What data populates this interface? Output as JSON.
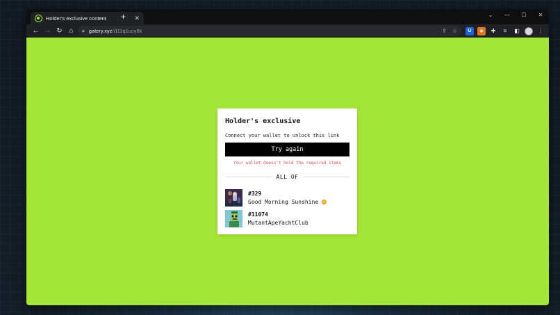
{
  "browser": {
    "tab": {
      "title": "Holder's exclusive content",
      "favicon": "gatery-icon"
    },
    "window_controls": [
      "chevron-down-icon",
      "minimize-icon",
      "maximize-icon",
      "close-icon"
    ],
    "url": {
      "host": "gatery.xyz",
      "path": "/i111q1ucy6k"
    },
    "extensions": [
      "bitwarden-icon",
      "metamask-icon",
      "puzzle-icon",
      "reading-list-icon",
      "sidebar-icon"
    ]
  },
  "page": {
    "background": "#a4e637"
  },
  "card": {
    "title": "Holder's exclusive",
    "subtitle": "Connect your wallet to unlock this link",
    "button_label": "Try again",
    "error": "Your wallet doesn't hold the required items",
    "divider_label": "ALL OF",
    "requirements": [
      {
        "id": "#329",
        "name": "Good Morning Sunshine"
      },
      {
        "id": "#11074",
        "name": "MutantApeYachtClub"
      }
    ]
  },
  "colors": {
    "accent": "#a4e637",
    "error": "#e5484d",
    "button": "#000000"
  }
}
